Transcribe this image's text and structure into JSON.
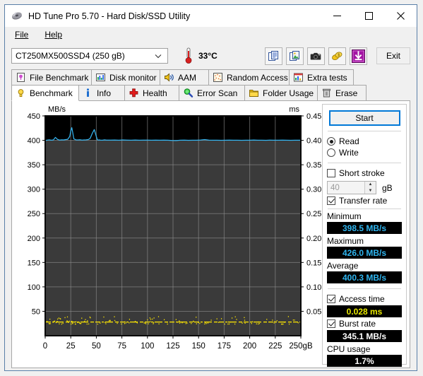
{
  "window": {
    "title": "HD Tune Pro 5.70 - Hard Disk/SSD Utility",
    "icon": "hdtune-disk-icon",
    "minimize": "–",
    "maximize": "□",
    "close": "✕"
  },
  "menu": [
    {
      "label": "File",
      "mnemonic": "F"
    },
    {
      "label": "Help",
      "mnemonic": "H"
    }
  ],
  "toolbar": {
    "drive_selected": "CT250MX500SSD4 (250 gB)",
    "dropdown_arrow": "⌄",
    "temperature": "33°C",
    "thermometer_icon": "thermometer-icon",
    "buttons": [
      {
        "name": "copy-text-icon",
        "title": "Copy text"
      },
      {
        "name": "copy-image-icon",
        "title": "Copy image"
      },
      {
        "name": "screenshot-camera-icon",
        "title": "Screenshot"
      },
      {
        "name": "donate-coins-icon",
        "title": "Donate"
      },
      {
        "name": "download-arrow-icon",
        "title": "Download"
      }
    ],
    "exit_label": "Exit"
  },
  "tabs_row1": [
    {
      "label": "File Benchmark",
      "icon": "file-benchmark-icon",
      "active": false
    },
    {
      "label": "Disk monitor",
      "icon": "disk-monitor-icon",
      "active": false
    },
    {
      "label": "AAM",
      "icon": "aam-speaker-icon",
      "active": false
    },
    {
      "label": "Random Access",
      "icon": "random-access-icon",
      "active": false
    },
    {
      "label": "Extra tests",
      "icon": "extra-tests-icon",
      "active": false
    }
  ],
  "tabs_row2": [
    {
      "label": "Benchmark",
      "icon": "benchmark-bulb-icon",
      "active": true
    },
    {
      "label": "Info",
      "icon": "info-icon",
      "active": false
    },
    {
      "label": "Health",
      "icon": "health-cross-icon",
      "active": false
    },
    {
      "label": "Error Scan",
      "icon": "error-scan-magnifier-icon",
      "active": false
    },
    {
      "label": "Folder Usage",
      "icon": "folder-usage-icon",
      "active": false
    },
    {
      "label": "Erase",
      "icon": "erase-trash-icon",
      "active": false
    }
  ],
  "panel": {
    "start_label": "Start",
    "read_label": "Read",
    "write_label": "Write",
    "read_selected": true,
    "write_selected": false,
    "short_stroke_label": "Short stroke",
    "short_stroke_checked": false,
    "short_stroke_value": "40",
    "short_stroke_unit": "gB",
    "spin_up": "▲",
    "spin_down": "▼",
    "transfer_rate_label": "Transfer rate",
    "transfer_rate_checked": true,
    "minimum_label": "Minimum",
    "minimum_value": "398.5 MB/s",
    "maximum_label": "Maximum",
    "maximum_value": "426.0 MB/s",
    "average_label": "Average",
    "average_value": "400.3 MB/s",
    "access_time_label": "Access time",
    "access_time_checked": true,
    "access_time_value": "0.028 ms",
    "burst_rate_label": "Burst rate",
    "burst_rate_checked": true,
    "burst_rate_value": "345.1 MB/s",
    "cpu_usage_label": "CPU usage",
    "cpu_usage_value": "1.7%"
  },
  "colors": {
    "transfer_rate_line": "#35b5f0",
    "access_time_dots": "#ffe800",
    "plot_upper_bg": "#000000",
    "plot_lower_bg": "#3a3a3a",
    "grid": "#8f8f8f",
    "accent": "#0078d7",
    "value_cyan": "#2fb5ef",
    "value_yellow": "#e8e800"
  },
  "chart_data": {
    "type": "line",
    "title": "",
    "xlabel": "gB",
    "ylabel": "MB/s",
    "y2label": "ms",
    "xlim": [
      0,
      250
    ],
    "ylim": [
      0,
      450
    ],
    "y2lim": [
      0,
      0.45
    ],
    "grid": true,
    "legend": "none",
    "xticks": [
      0,
      25,
      50,
      75,
      100,
      125,
      150,
      175,
      200,
      225,
      250
    ],
    "xticklabels": [
      "0",
      "25",
      "50",
      "75",
      "100",
      "125",
      "150",
      "175",
      "200",
      "225",
      "250gB"
    ],
    "yticks": [
      50,
      100,
      150,
      200,
      250,
      300,
      350,
      400,
      450
    ],
    "yticklabels": [
      "50",
      "100",
      "150",
      "200",
      "250",
      "300",
      "350",
      "400",
      "450"
    ],
    "y2ticks": [
      0.05,
      0.1,
      0.15,
      0.2,
      0.25,
      0.3,
      0.35,
      0.4,
      0.45
    ],
    "y2ticklabels": [
      "0.05",
      "0.10",
      "0.15",
      "0.20",
      "0.25",
      "0.30",
      "0.35",
      "0.40",
      "0.45"
    ],
    "series": [
      {
        "name": "Transfer rate",
        "axis": "left",
        "units": "MB/s",
        "color": "#35b5f0",
        "style": "line",
        "x": [
          0,
          2,
          4,
          6,
          8,
          10,
          12,
          14,
          16,
          18,
          20,
          22,
          24,
          25,
          26,
          27,
          28,
          30,
          32,
          34,
          36,
          38,
          40,
          42,
          44,
          46,
          48,
          50,
          51,
          52,
          53,
          54,
          56,
          58,
          60,
          64,
          68,
          72,
          76,
          80,
          84,
          88,
          92,
          96,
          100,
          104,
          108,
          112,
          116,
          120,
          124,
          128,
          132,
          136,
          140,
          144,
          148,
          152,
          156,
          160,
          164,
          168,
          172,
          176,
          180,
          184,
          188,
          192,
          196,
          200,
          204,
          208,
          212,
          216,
          220,
          224,
          228,
          232,
          236,
          240,
          244,
          248,
          250
        ],
        "y": [
          399.5,
          400.5,
          401,
          400.3,
          400.8,
          406,
          402,
          400.5,
          401,
          400.8,
          401.5,
          402,
          408,
          419,
          426,
          415,
          403,
          401,
          400.8,
          401.2,
          400.5,
          400.8,
          401,
          401.5,
          404,
          414,
          422,
          408,
          401,
          400.6,
          400.8,
          400.5,
          400.3,
          401,
          400.5,
          400.4,
          400.6,
          400.3,
          400.8,
          400.5,
          400.3,
          400.6,
          400.2,
          400.4,
          400.5,
          400.3,
          400.4,
          400.2,
          400.5,
          400.3,
          399.8,
          399.5,
          400.2,
          400.4,
          400.1,
          400.3,
          400.2,
          400.6,
          401.5,
          400.4,
          400.2,
          400.3,
          400.1,
          400.2,
          400.4,
          400.2,
          400.3,
          400.1,
          400.2,
          400.3,
          400.6,
          400.2,
          400.3,
          400.1,
          400.5,
          400.3,
          400.2,
          400.4,
          400.2,
          400.1,
          400.3,
          400.2,
          400.4
        ]
      },
      {
        "name": "Access time",
        "axis": "right",
        "units": "ms",
        "color": "#ffe800",
        "style": "scatter",
        "mean": 0.028,
        "spread": [
          0.024,
          0.04
        ]
      }
    ],
    "summary": {
      "minimum": 398.5,
      "maximum": 426.0,
      "average": 400.3,
      "access_time_ms": 0.028,
      "burst_rate": 345.1,
      "cpu_usage_pct": 1.7
    }
  }
}
